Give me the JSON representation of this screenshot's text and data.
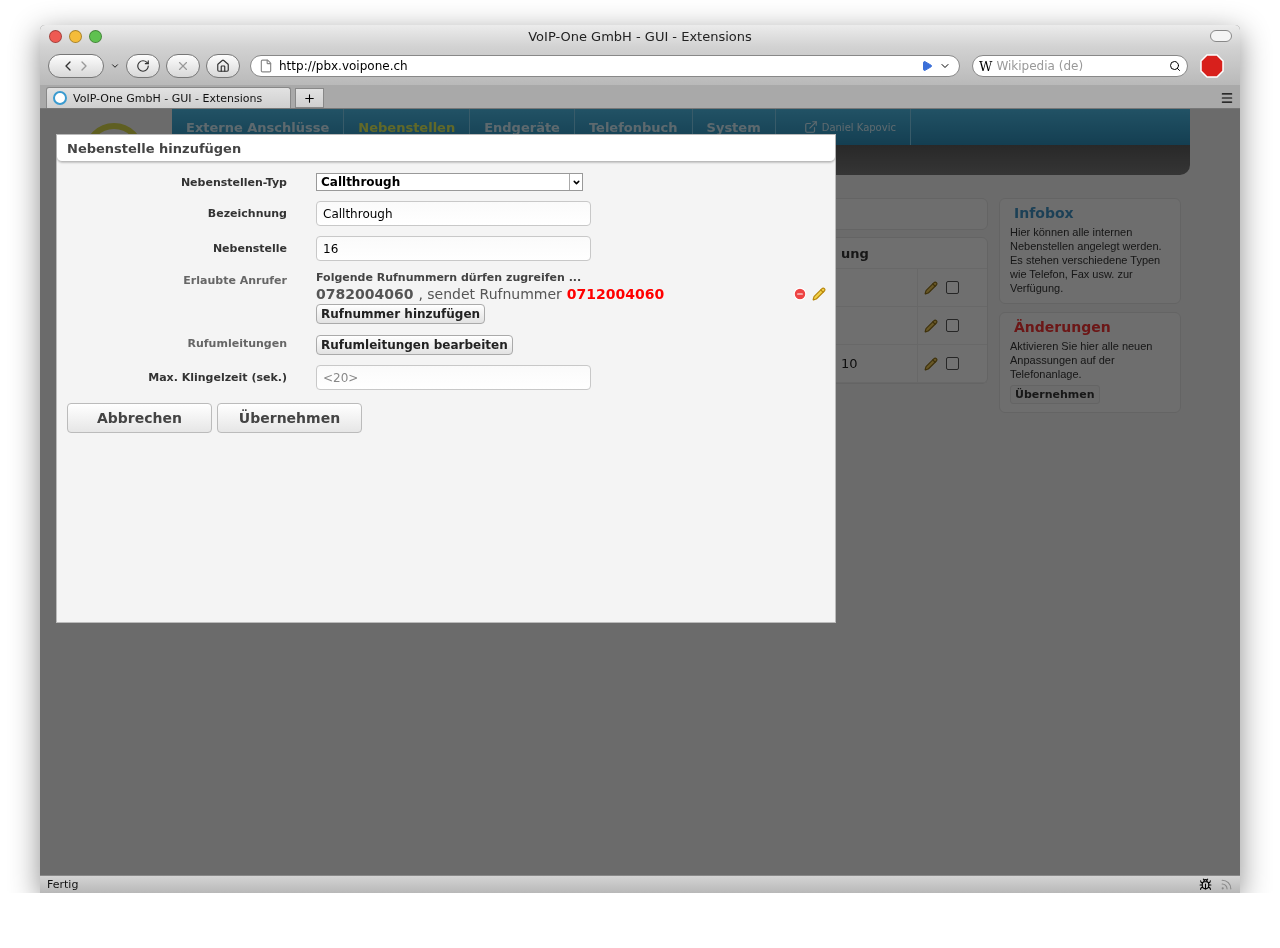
{
  "browser": {
    "title": "VoIP-One GmbH - GUI - Extensions",
    "url": "http://pbx.voipone.ch",
    "search_engine": "W",
    "search_placeholder": "Wikipedia (de)",
    "tab_title": "VoIP-One GmbH - GUI - Extensions",
    "status": "Fertig"
  },
  "page": {
    "nav": [
      {
        "label": "Externe Anschlüsse",
        "selected": false
      },
      {
        "label": "Nebenstellen",
        "selected": true
      },
      {
        "label": "Endgeräte",
        "selected": false
      },
      {
        "label": "Telefonbuch",
        "selected": false
      },
      {
        "label": "System",
        "selected": false
      }
    ],
    "user": "Daniel Kapovic",
    "table": {
      "column_header": "ung",
      "rows": [
        {
          "cell": "",
          "checked": false
        },
        {
          "cell": "",
          "checked": false
        },
        {
          "cell": "10",
          "checked": false
        }
      ]
    },
    "infobox": {
      "title": "Infobox",
      "text": "Hier können alle internen Nebenstellen angelegt werden. Es stehen verschiedene Typen wie Telefon, Fax usw. zur Verfügung."
    },
    "changes": {
      "title": "Änderungen",
      "text": "Aktivieren Sie hier alle neuen Anpassungen auf der Telefonanlage.",
      "button": "Übernehmen"
    }
  },
  "dialog": {
    "title": "Nebenstelle hinzufügen",
    "fields": [
      {
        "kind": "select",
        "label": "Nebenstellen-Typ",
        "value": "Callthrough"
      },
      {
        "kind": "text",
        "label": "Bezeichnung",
        "value": "Callthrough"
      },
      {
        "kind": "text",
        "label": "Nebenstelle",
        "value": "16"
      },
      {
        "kind": "callers",
        "label": "Erlaubte Anrufer",
        "intro": "Folgende Rufnummern dürfen zugreifen ...",
        "callers": [
          {
            "number": "0782004060",
            "separator": ", sendet Rufnummer",
            "sends": "0712004060"
          }
        ],
        "button": "Rufnummer hinzufügen"
      },
      {
        "kind": "button",
        "label": "Rufumleitungen",
        "button": "Rufumleitungen bearbeiten"
      },
      {
        "kind": "text",
        "label": "Max. Klingelzeit (sek.)",
        "placeholder": "<20>"
      }
    ],
    "actions": [
      "Abbrechen",
      "Übernehmen"
    ]
  }
}
